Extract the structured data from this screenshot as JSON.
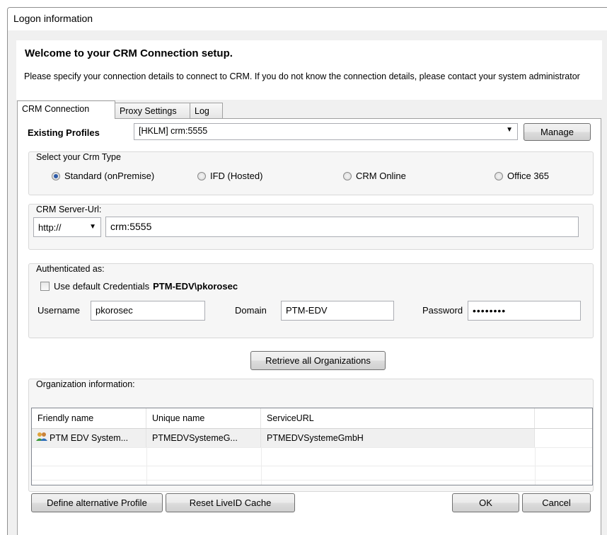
{
  "window": {
    "title": "Logon information"
  },
  "header": {
    "title": "Welcome to your CRM Connection setup.",
    "description": "Please specify your connection details to connect to CRM. If you do not know the connection details, please contact your system administrator"
  },
  "tabs": [
    {
      "label": "CRM Connection",
      "active": true
    },
    {
      "label": "Proxy Settings",
      "active": false
    },
    {
      "label": "Log",
      "active": false
    }
  ],
  "profiles": {
    "label": "Existing Profiles",
    "selected": "[HKLM] crm:5555",
    "manage_label": "Manage"
  },
  "crm_type": {
    "label": "Select your Crm Type",
    "options": [
      {
        "label": "Standard (onPremise)",
        "selected": true
      },
      {
        "label": "IFD (Hosted)",
        "selected": false
      },
      {
        "label": "CRM Online",
        "selected": false
      },
      {
        "label": "Office 365",
        "selected": false
      }
    ]
  },
  "server": {
    "label": "CRM Server-Url:",
    "protocol": "http://",
    "url": "crm:5555"
  },
  "auth": {
    "label": "Authenticated as:",
    "default_credentials_label": "Use default Credentials",
    "default_credentials_user": "PTM-EDV\\pkorosec",
    "default_credentials_checked": false,
    "username_label": "Username",
    "username": "pkorosec",
    "domain_label": "Domain",
    "domain": "PTM-EDV",
    "password_label": "Password",
    "password_mask": "••••••••"
  },
  "retrieve_label": "Retrieve all Organizations",
  "organizations": {
    "label": "Organization information:",
    "columns": [
      "Friendly name",
      "Unique name",
      "ServiceURL",
      ""
    ],
    "rows": [
      {
        "friendly": "PTM EDV System...",
        "unique": "PTMEDVSystemeG...",
        "url": "PTMEDVSystemeGmbH"
      }
    ]
  },
  "footer": {
    "define_label": "Define alternative Profile",
    "reset_label": "Reset LiveID Cache",
    "ok_label": "OK",
    "cancel_label": "Cancel"
  }
}
